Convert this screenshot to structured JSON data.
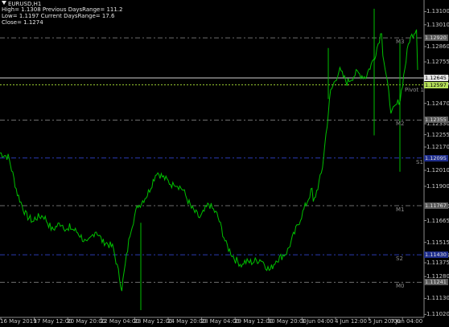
{
  "header": {
    "symbol": "EURUSD,H1",
    "line1": "High= 1.1308 Previous DaysRange= 111.2",
    "line2": "Low= 1.1197 Current DaysRange= 17.6",
    "line3": "Close= 1.1274"
  },
  "y_axis": {
    "ticks": [
      "1.13100",
      "1.13010",
      "1.12860",
      "1.12755",
      "1.12645",
      "1.12597",
      "1.12470",
      "1.12330",
      "1.12255",
      "1.12170",
      "1.12010",
      "1.11900",
      "1.11760",
      "1.11665",
      "1.11515",
      "1.11425",
      "1.11375",
      "1.11280",
      "1.11130",
      "1.11020"
    ]
  },
  "tags": [
    {
      "text": "1.12920",
      "bg": "#5a5a5a",
      "fg": "#e0e0e0"
    },
    {
      "text": "1.12645",
      "bg": "#e8e8e8",
      "fg": "#000000"
    },
    {
      "text": "1.12597",
      "bg": "#b6e05a",
      "fg": "#000000"
    },
    {
      "text": "1.12355",
      "bg": "#5a5a5a",
      "fg": "#e0e0e0"
    },
    {
      "text": "1.12095",
      "bg": "#1e2d8c",
      "fg": "#e0e0e0"
    },
    {
      "text": "1.11767",
      "bg": "#5a5a5a",
      "fg": "#e0e0e0"
    },
    {
      "text": "1.11430",
      "bg": "#1e2d8c",
      "fg": "#e0e0e0"
    },
    {
      "text": "1.11241",
      "bg": "#5a5a5a",
      "fg": "#e0e0e0"
    }
  ],
  "levels": [
    {
      "label": "M3",
      "price": 1.1292,
      "color": "#6e6e6e"
    },
    {
      "label": "Pivot 1",
      "price": 1.12597,
      "color": "#9acd32"
    },
    {
      "label": "M2",
      "price": 1.12355,
      "color": "#6e6e6e"
    },
    {
      "label": "S1",
      "price": 1.12095,
      "color": "#2a3ab0"
    },
    {
      "label": "M1",
      "price": 1.11767,
      "color": "#6e6e6e"
    },
    {
      "label": "S2",
      "price": 1.1143,
      "color": "#2a3ab0"
    },
    {
      "label": "M0",
      "price": 1.11241,
      "color": "#6e6e6e"
    }
  ],
  "x_axis": {
    "ticks": [
      "16 May 2019",
      "17 May 12:00",
      "20 May 20:00",
      "22 May 04:00",
      "23 May 12:00",
      "24 May 20:00",
      "28 May 04:00",
      "29 May 12:00",
      "30 May 20:00",
      "3 Jun 04:00",
      "4 Jun 12:00",
      "5 Jun 20:00",
      "7 Jun 04:00"
    ]
  },
  "current": {
    "bid_line_price": 1.12645,
    "bid_line_color": "#d0d0d0"
  },
  "chart_data": {
    "type": "line",
    "symbol": "EURUSD",
    "timeframe": "H1",
    "series": [
      {
        "color": "#00c000",
        "x": [
          "16 May 2019",
          "17 May 12:00",
          "20 May 20:00",
          "22 May 04:00",
          "23 May 12:00",
          "24 May 20:00",
          "28 May 04:00",
          "29 May 12:00",
          "30 May 20:00",
          "3 Jun 04:00",
          "4 Jun 12:00",
          "5 Jun 20:00",
          "7 Jun 04:00"
        ],
        "values": [
          1.1213,
          1.1168,
          1.1162,
          1.1152,
          1.1177,
          1.1193,
          1.1178,
          1.1138,
          1.114,
          1.1178,
          1.1262,
          1.1282,
          1.127
        ]
      }
    ],
    "ylim": [
      1.11,
      1.1318
    ],
    "grid": false
  }
}
